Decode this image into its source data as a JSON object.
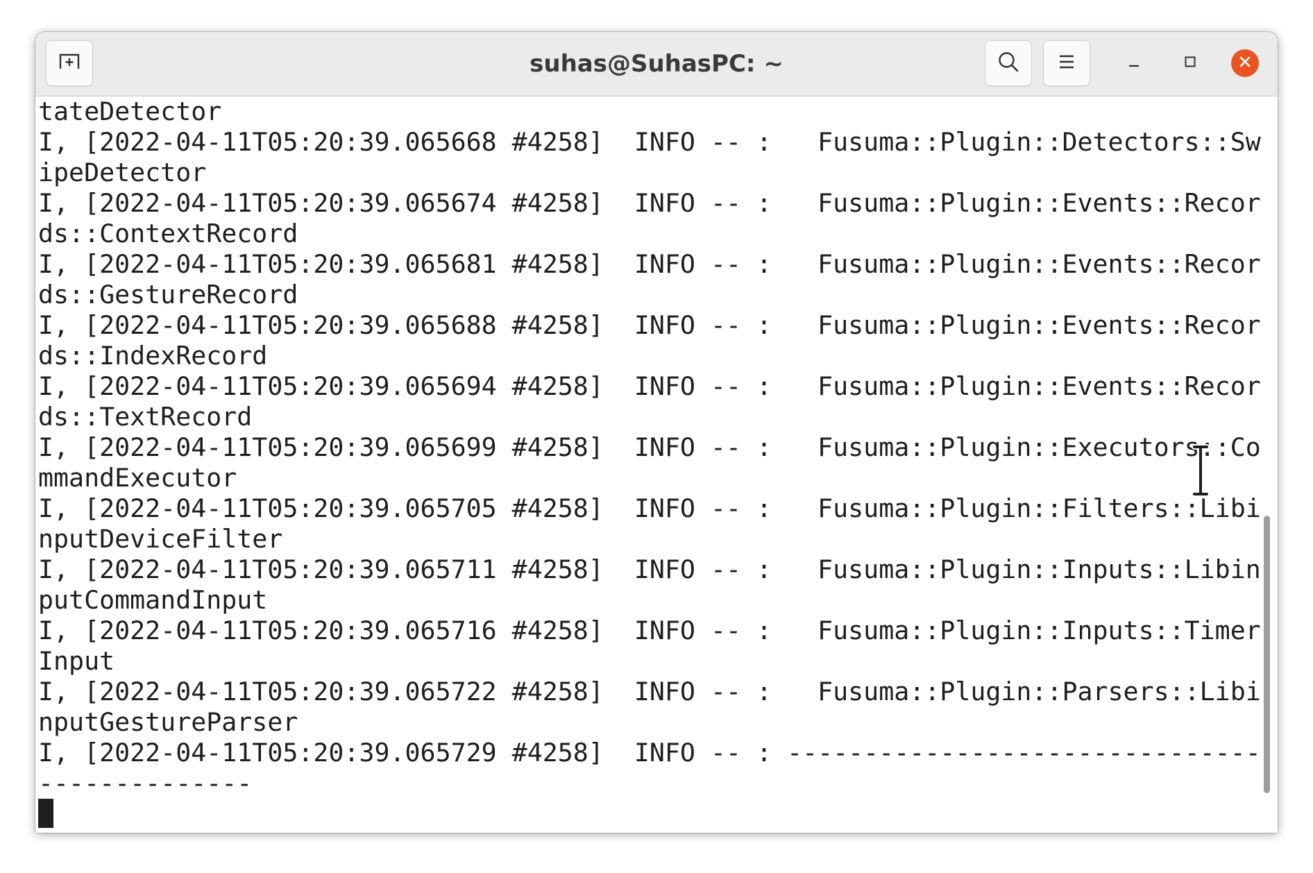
{
  "window": {
    "title": "suhas@SuhasPC: ~"
  },
  "header": {
    "new_tab_icon": "new-tab-icon",
    "search_icon": "search-icon",
    "menu_icon": "hamburger-menu-icon",
    "minimize_icon": "minimize-icon",
    "maximize_icon": "maximize-icon",
    "close_icon": "close-icon",
    "close_color": "#e95420"
  },
  "terminal": {
    "lines": [
      "tateDetector",
      "I, [2022-04-11T05:20:39.065668 #4258]  INFO -- :   Fusuma::Plugin::Detectors::Sw",
      "ipeDetector",
      "I, [2022-04-11T05:20:39.065674 #4258]  INFO -- :   Fusuma::Plugin::Events::Recor",
      "ds::ContextRecord",
      "I, [2022-04-11T05:20:39.065681 #4258]  INFO -- :   Fusuma::Plugin::Events::Recor",
      "ds::GestureRecord",
      "I, [2022-04-11T05:20:39.065688 #4258]  INFO -- :   Fusuma::Plugin::Events::Recor",
      "ds::IndexRecord",
      "I, [2022-04-11T05:20:39.065694 #4258]  INFO -- :   Fusuma::Plugin::Events::Recor",
      "ds::TextRecord",
      "I, [2022-04-11T05:20:39.065699 #4258]  INFO -- :   Fusuma::Plugin::Executors::Co",
      "mmandExecutor",
      "I, [2022-04-11T05:20:39.065705 #4258]  INFO -- :   Fusuma::Plugin::Filters::Libi",
      "nputDeviceFilter",
      "I, [2022-04-11T05:20:39.065711 #4258]  INFO -- :   Fusuma::Plugin::Inputs::Libin",
      "putCommandInput",
      "I, [2022-04-11T05:20:39.065716 #4258]  INFO -- :   Fusuma::Plugin::Inputs::Timer",
      "Input",
      "I, [2022-04-11T05:20:39.065722 #4258]  INFO -- :   Fusuma::Plugin::Parsers::Libi",
      "nputGestureParser",
      "I, [2022-04-11T05:20:39.065729 #4258]  INFO -- : -------------------------------",
      "--------------"
    ],
    "text_color": "#1e1e1e",
    "background": "#ffffff"
  }
}
